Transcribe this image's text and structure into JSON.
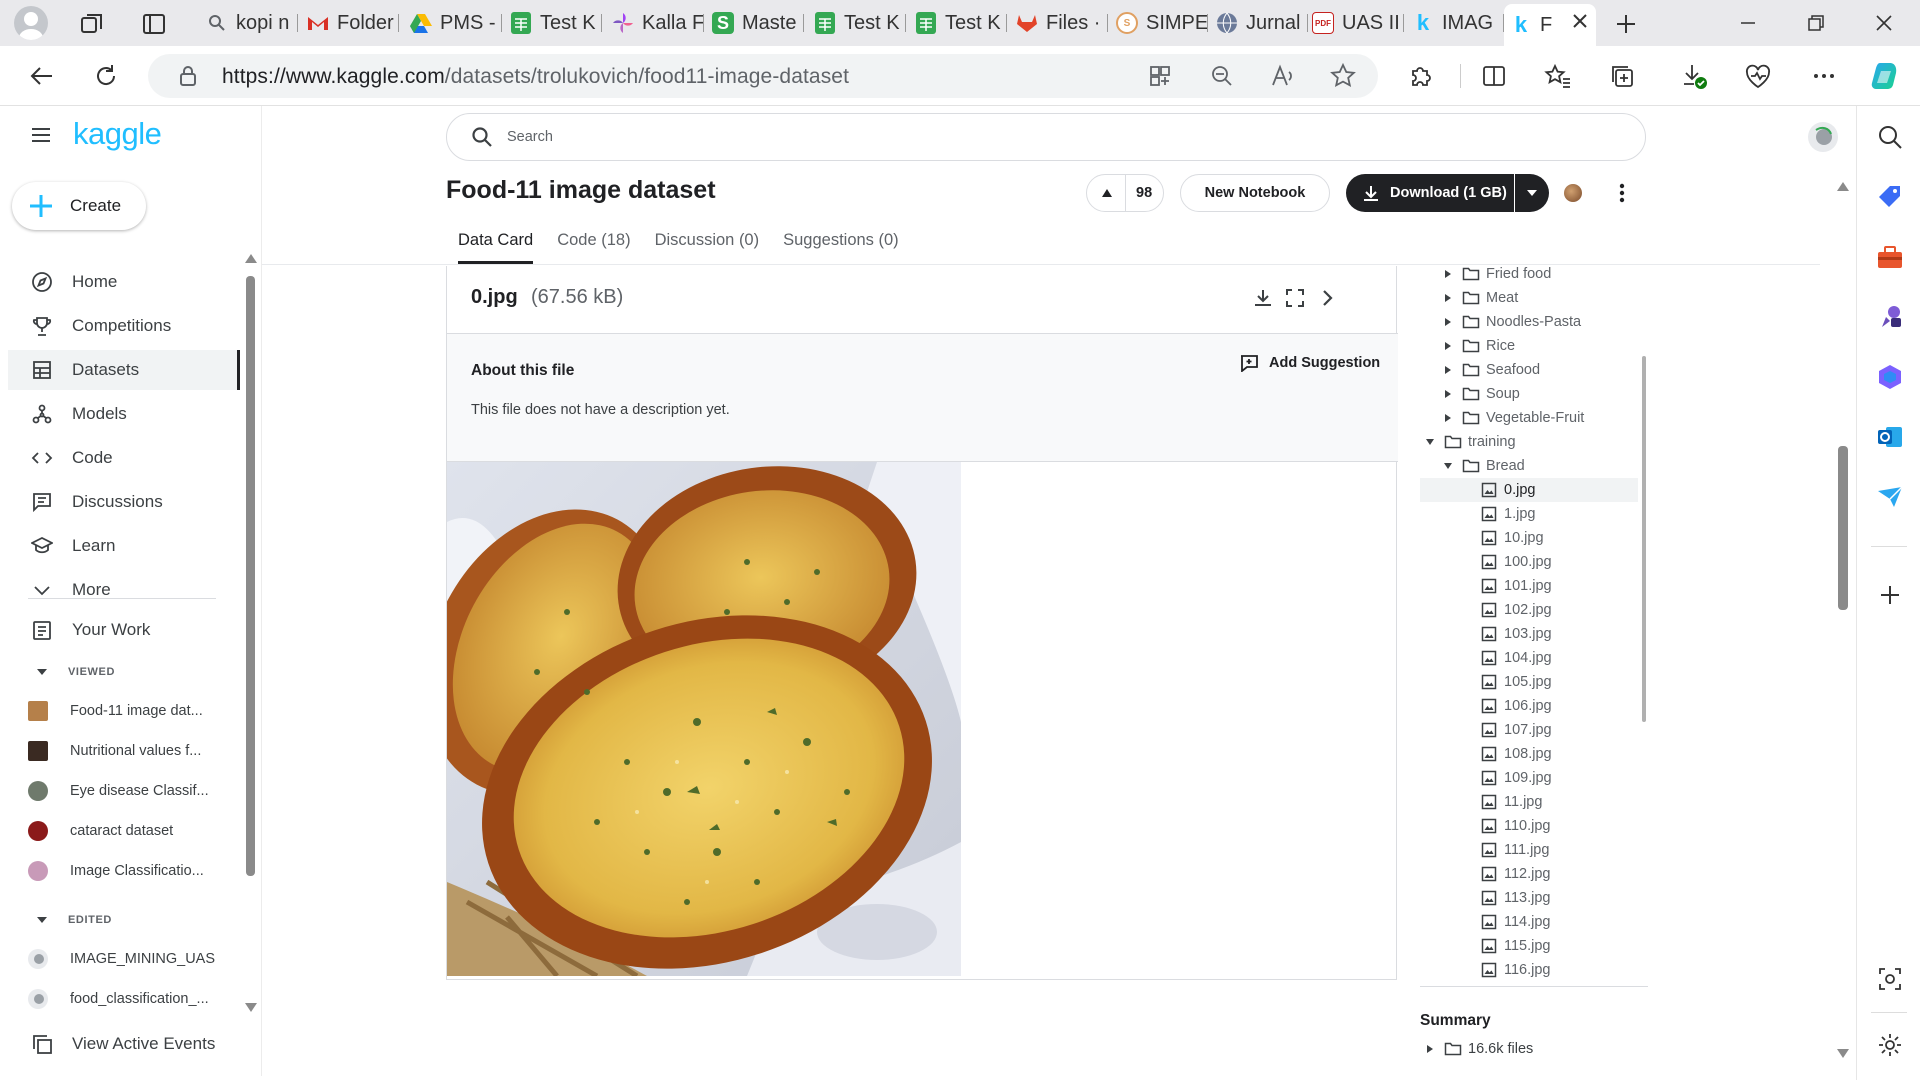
{
  "browser": {
    "tabs": [
      {
        "label": "kopi n",
        "icon": "search-icon",
        "color": "#5f6368"
      },
      {
        "label": "Folder",
        "icon": "gmail-icon",
        "color": "#d93025"
      },
      {
        "label": "PMS -",
        "icon": "drive-icon",
        "color": "#1a73e8"
      },
      {
        "label": "Test K",
        "icon": "sheets-icon",
        "color": "#34a853"
      },
      {
        "label": "Kalla F",
        "icon": "pinwheel-icon",
        "color": "#a142f4"
      },
      {
        "label": "Maste",
        "icon": "s-icon",
        "color": "#34a853"
      },
      {
        "label": "Test K",
        "icon": "sheets-icon",
        "color": "#34a853"
      },
      {
        "label": "Test K",
        "icon": "sheets-icon",
        "color": "#34a853"
      },
      {
        "label": "Files ·",
        "icon": "gitlab-icon",
        "color": "#e24329"
      },
      {
        "label": "SIMPE",
        "icon": "simpe-icon",
        "color": "#e0a062"
      },
      {
        "label": "Jurnal",
        "icon": "globe-icon",
        "color": "#6b7a99"
      },
      {
        "label": "UAS II",
        "icon": "pdf-icon",
        "color": "#c5221f"
      },
      {
        "label": "IMAG",
        "icon": "kaggle-k-icon",
        "color": "#20beff"
      },
      {
        "label": "F",
        "icon": "kaggle-k-icon",
        "color": "#20beff"
      }
    ],
    "url_host": "https://www.kaggle.com",
    "url_path": "/datasets/trolukovich/food11-image-dataset"
  },
  "kaggle": {
    "logo": "kaggle",
    "create": "Create",
    "nav": [
      {
        "label": "Home",
        "icon": "compass-icon"
      },
      {
        "label": "Competitions",
        "icon": "trophy-icon"
      },
      {
        "label": "Datasets",
        "icon": "table-icon"
      },
      {
        "label": "Models",
        "icon": "models-icon"
      },
      {
        "label": "Code",
        "icon": "code-icon"
      },
      {
        "label": "Discussions",
        "icon": "discussion-icon"
      },
      {
        "label": "Learn",
        "icon": "learn-icon"
      },
      {
        "label": "More",
        "icon": "chevron-down-icon"
      }
    ],
    "your_work": "Your Work",
    "viewed_header": "VIEWED",
    "viewed": [
      {
        "label": "Food-11 image dat...",
        "color": "#b5804a"
      },
      {
        "label": "Nutritional values f...",
        "color": "#3a2a22"
      },
      {
        "label": "Eye disease Classif...",
        "color": "#6f7a6c"
      },
      {
        "label": "cataract dataset",
        "color": "#8b1a1a"
      },
      {
        "label": "Image Classificatio...",
        "color": "#c89ab8"
      }
    ],
    "edited_header": "EDITED",
    "edited": [
      {
        "label": "IMAGE_MINING_UAS",
        "color": "#9aa0a6"
      },
      {
        "label": "food_classification_...",
        "color": "#9aa0a6"
      }
    ],
    "view_active_events": "View Active Events"
  },
  "main": {
    "search_placeholder": "Search",
    "title": "Food-11 image dataset",
    "votes": "98",
    "new_notebook": "New Notebook",
    "download": "Download (1 GB)",
    "tabs": [
      "Data Card",
      "Code (18)",
      "Discussion (0)",
      "Suggestions (0)"
    ],
    "file_name": "0.jpg",
    "file_size": "(67.56 kB)",
    "about_title": "About this file",
    "add_suggestion": "Add Suggestion",
    "about_text": "This file does not have a description yet."
  },
  "tree": {
    "folders_top": [
      "Fried food",
      "Meat",
      "Noodles-Pasta",
      "Rice",
      "Seafood",
      "Soup",
      "Vegetable-Fruit"
    ],
    "training": "training",
    "bread": "Bread",
    "files": [
      "0.jpg",
      "1.jpg",
      "10.jpg",
      "100.jpg",
      "101.jpg",
      "102.jpg",
      "103.jpg",
      "104.jpg",
      "105.jpg",
      "106.jpg",
      "107.jpg",
      "108.jpg",
      "109.jpg",
      "11.jpg",
      "110.jpg",
      "111.jpg",
      "112.jpg",
      "113.jpg",
      "114.jpg",
      "115.jpg",
      "116.jpg"
    ],
    "summary_title": "Summary",
    "summary_files": "16.6k files"
  }
}
